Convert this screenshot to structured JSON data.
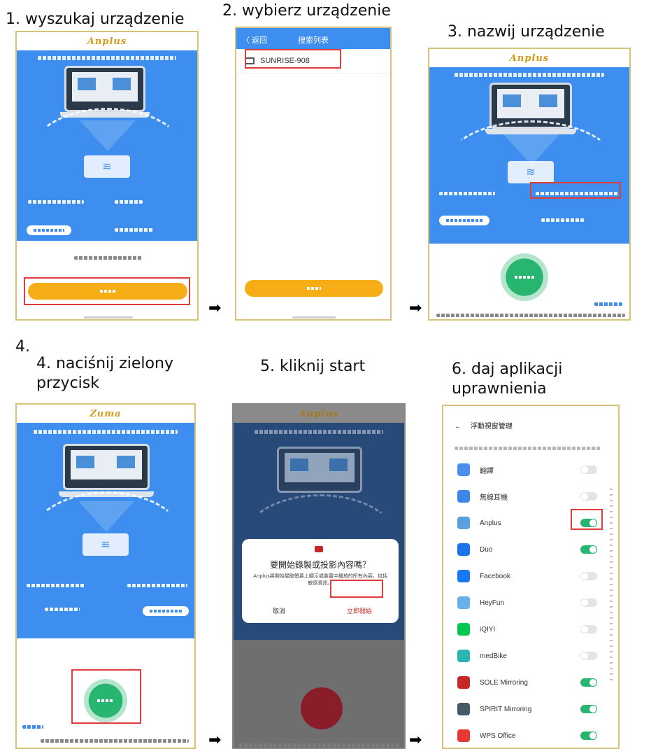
{
  "captions": {
    "step1": "1. wyszukaj urządzenie",
    "step2": "2. wybierz urządzenie",
    "step3": "3. nazwij urządzenie",
    "step4_num": "4.",
    "step4": "4. naciśnij zielony przycisk",
    "step5": "5. kliknij start",
    "step6": "6. daj aplikacji uprawnienia"
  },
  "arrow_glyph": "➡",
  "wifi_glyph": "≋",
  "phone2": {
    "back_label": "〈 返回",
    "title": "搜索列表",
    "device_name": "SUNRISE-908"
  },
  "phone5": {
    "dialog_title": "要開始錄製或投影內容嗎？",
    "dialog_body": "Anplus將開始擷取螢幕上顯示或裝置中播放的所有內容，包括敏感資訊。",
    "cancel": "取消",
    "start_now": "立即開始"
  },
  "phone6": {
    "back_icon": "←",
    "title": "浮動視窗管理",
    "apps": [
      {
        "name": "翻譯",
        "icon": "translate-icon",
        "color": "#4a8ef0",
        "on": false
      },
      {
        "name": "無線耳機",
        "icon": "headphones-icon",
        "color": "#3c86e8",
        "on": false
      },
      {
        "name": "Anplus",
        "icon": "anplus-icon",
        "color": "#5a9fe0",
        "on": true
      },
      {
        "name": "Duo",
        "icon": "video-icon",
        "color": "#1a73e8",
        "on": true
      },
      {
        "name": "Facebook",
        "icon": "facebook-icon",
        "color": "#1877f2",
        "on": false
      },
      {
        "name": "HeyFun",
        "icon": "heyfun-icon",
        "color": "#6ab0e8",
        "on": false
      },
      {
        "name": "iQIYI",
        "icon": "iqiyi-icon",
        "color": "#00c853",
        "on": false
      },
      {
        "name": "medBike",
        "icon": "bike-icon",
        "color": "#2bb5b0",
        "on": false
      },
      {
        "name": "SOLE Mirroring",
        "icon": "sole-icon",
        "color": "#c62828",
        "on": true
      },
      {
        "name": "SPIRIT Mirroring",
        "icon": "spirit-icon",
        "color": "#455a64",
        "on": true
      },
      {
        "name": "WPS Office",
        "icon": "wps-icon",
        "color": "#e53935",
        "on": true
      }
    ]
  }
}
